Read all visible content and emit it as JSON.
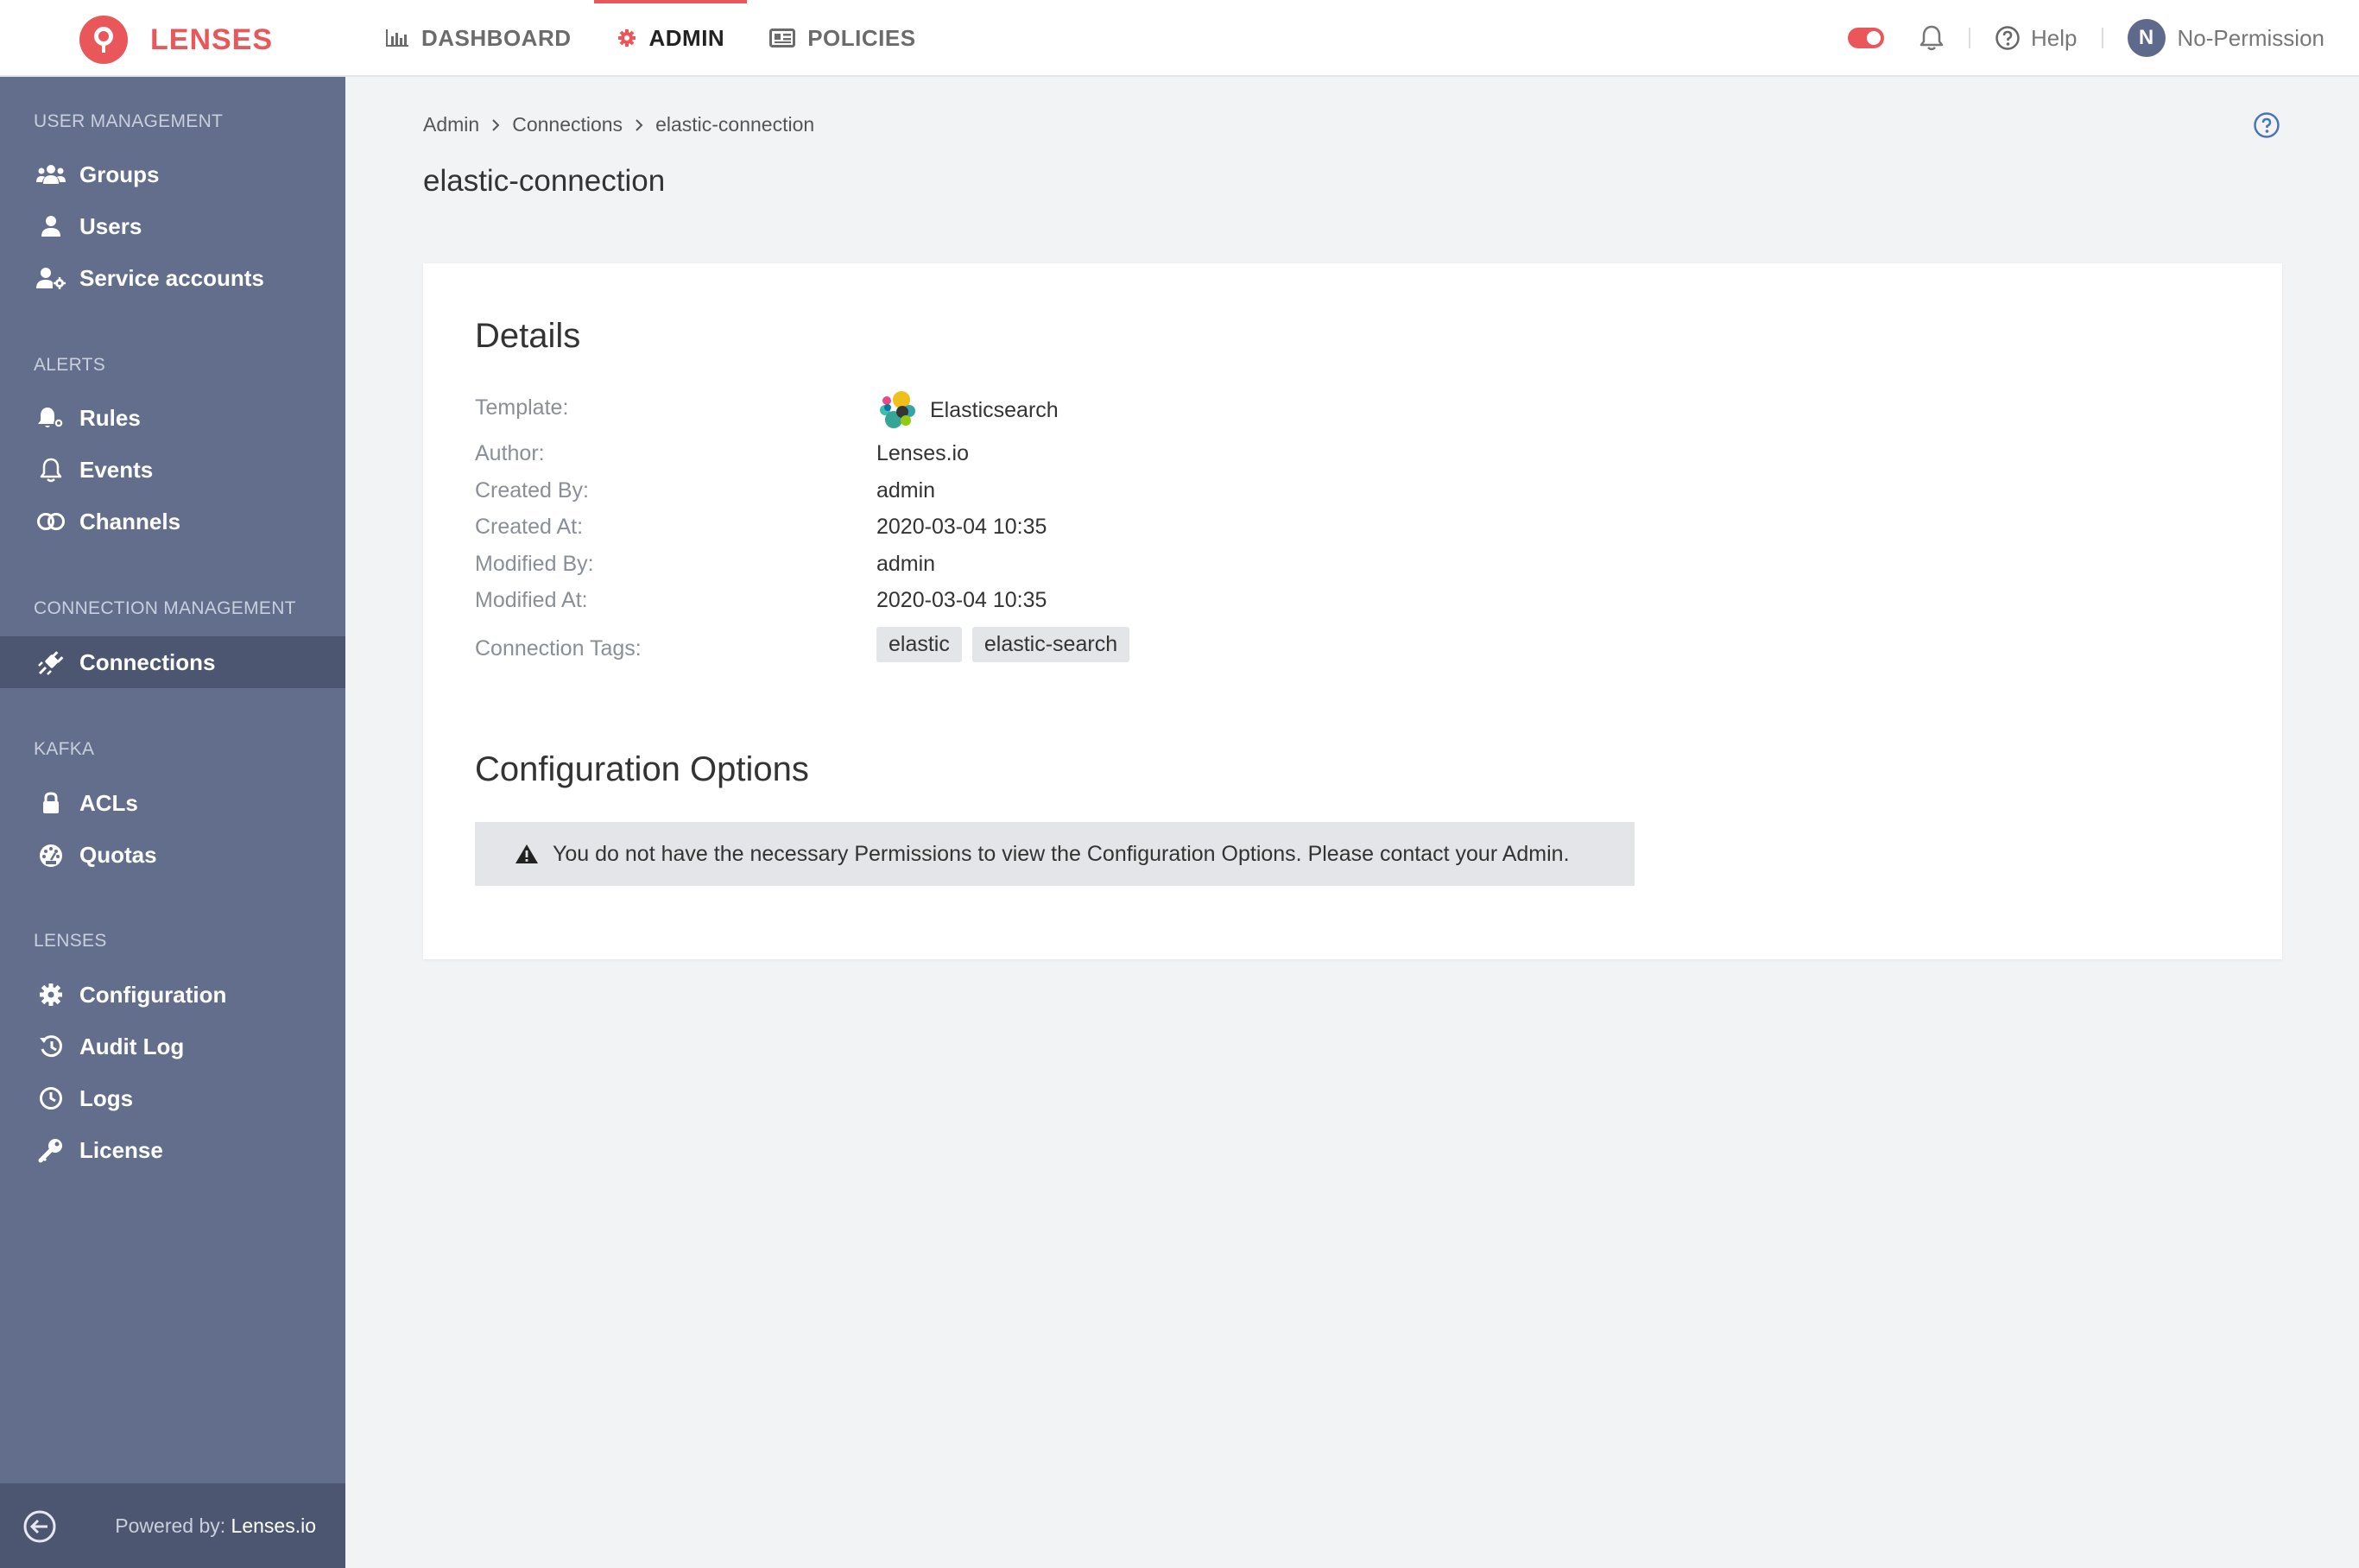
{
  "brand": {
    "name": "LENSES",
    "color": "#e9575b"
  },
  "nav": {
    "dashboard": "DASHBOARD",
    "admin": "ADMIN",
    "policies": "POLICIES"
  },
  "topbar": {
    "help": "Help",
    "user_initial": "N",
    "user_name": "No-Permission"
  },
  "sidebar": {
    "sections": {
      "user_management": "USER MANAGEMENT",
      "alerts": "ALERTS",
      "connection_management": "CONNECTION MANAGEMENT",
      "kafka": "KAFKA",
      "lenses": "LENSES"
    },
    "items": {
      "groups": "Groups",
      "users": "Users",
      "service_accounts": "Service accounts",
      "rules": "Rules",
      "events": "Events",
      "channels": "Channels",
      "connections": "Connections",
      "acls": "ACLs",
      "quotas": "Quotas",
      "configuration": "Configuration",
      "audit_log": "Audit Log",
      "logs": "Logs",
      "license": "License"
    },
    "footer": {
      "powered_by": "Powered by:",
      "vendor": "Lenses.io"
    }
  },
  "breadcrumb": [
    "Admin",
    "Connections",
    "elastic-connection"
  ],
  "page_title": "elastic-connection",
  "details": {
    "heading": "Details",
    "template_label": "Template:",
    "template_value": "Elasticsearch",
    "author_label": "Author:",
    "author_value": "Lenses.io",
    "created_by_label": "Created By:",
    "created_by_value": "admin",
    "created_at_label": "Created At:",
    "created_at_value": "2020-03-04 10:35",
    "modified_by_label": "Modified By:",
    "modified_by_value": "admin",
    "modified_at_label": "Modified At:",
    "modified_at_value": "2020-03-04 10:35",
    "tags_label": "Connection Tags:",
    "tags": [
      "elastic",
      "elastic-search"
    ]
  },
  "config": {
    "heading": "Configuration Options",
    "warning": "You do not have the necessary Permissions to view the Configuration Options. Please contact your Admin."
  }
}
